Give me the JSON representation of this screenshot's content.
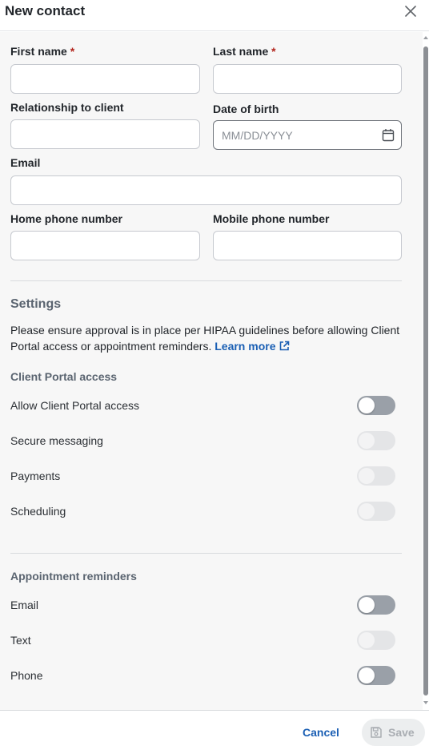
{
  "dialog": {
    "title": "New contact",
    "close_icon": "close-icon"
  },
  "form": {
    "first_name": {
      "label": "First name",
      "required_mark": "*",
      "value": ""
    },
    "last_name": {
      "label": "Last name",
      "required_mark": "*",
      "value": ""
    },
    "relationship": {
      "label": "Relationship to client",
      "value": ""
    },
    "date_of_birth": {
      "label": "Date of birth",
      "placeholder": "MM/DD/YYYY",
      "icon": "calendar-icon"
    },
    "email": {
      "label": "Email",
      "value": ""
    },
    "home_phone": {
      "label": "Home phone number",
      "value": ""
    },
    "mobile_phone": {
      "label": "Mobile phone number",
      "value": ""
    }
  },
  "settings": {
    "title": "Settings",
    "notice": "Please ensure approval is in place per HIPAA guidelines before allowing Client Portal access or appointment reminders.",
    "learn_more": "Learn more",
    "learn_more_icon": "external-link-icon",
    "client_portal": {
      "title": "Client Portal access",
      "items": [
        {
          "label": "Allow Client Portal access",
          "state": "off",
          "enabled": true
        },
        {
          "label": "Secure messaging",
          "state": "off",
          "enabled": false
        },
        {
          "label": "Payments",
          "state": "off",
          "enabled": false
        },
        {
          "label": "Scheduling",
          "state": "off",
          "enabled": false
        }
      ]
    },
    "reminders": {
      "title": "Appointment reminders",
      "items": [
        {
          "label": "Email",
          "state": "off",
          "enabled": true
        },
        {
          "label": "Text",
          "state": "off",
          "enabled": false
        },
        {
          "label": "Phone",
          "state": "off",
          "enabled": true
        }
      ]
    }
  },
  "footer": {
    "cancel_label": "Cancel",
    "save_label": "Save",
    "save_icon": "floppy-disk-icon"
  },
  "colors": {
    "accent": "#1a5fb4",
    "required": "#b3261e",
    "toggle_enabled": "#9aa0a8",
    "toggle_disabled": "#e4e5e7"
  }
}
